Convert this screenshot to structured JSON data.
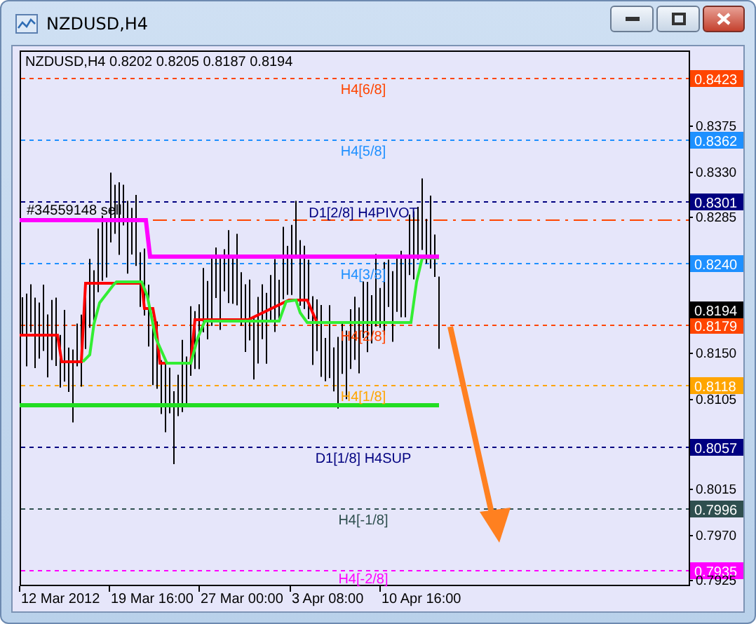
{
  "window": {
    "title": "NZDUSD,H4"
  },
  "chart": {
    "header": "NZDUSD,H4  0.8202 0.8205 0.8187 0.8194",
    "order_label": "#34559148 sell",
    "levels": [
      {
        "label": "H4[6/8]",
        "tag": "0.8423",
        "color": "#ff4500"
      },
      {
        "label": "H4[5/8]",
        "tag": "0.8362",
        "color": "#1e90ff"
      },
      {
        "label": "D1[2/8] H4PIVOT",
        "tag": "0.8301",
        "color": "#000080"
      },
      {
        "label": "H4[3/8]",
        "tag": "0.8240",
        "color": "#1e90ff"
      },
      {
        "label": "H4[2/8]",
        "tag": "0.8179",
        "color": "#ff4500"
      },
      {
        "label": "H4[1/8]",
        "tag": "0.8118",
        "color": "#ffa500"
      },
      {
        "label": "D1[1/8] H4SUP",
        "tag": "0.8057",
        "color": "#000080"
      },
      {
        "label": "H4[-1/8]",
        "tag": "0.7996",
        "color": "#2f4f4f"
      },
      {
        "label": "H4[-2/8]",
        "tag": "0.7935",
        "color": "#ff00ff"
      }
    ],
    "current_price": "0.8194",
    "price_ticks": [
      "0.8375",
      "0.8330",
      "0.8285",
      "0.8150",
      "0.8105",
      "0.8015",
      "0.7970",
      "0.7925"
    ],
    "time_ticks": [
      "12 Mar 2012",
      "19 Mar 16:00",
      "27 Mar 00:00",
      "3 Apr 08:00",
      "10 Apr 16:00"
    ]
  }
}
